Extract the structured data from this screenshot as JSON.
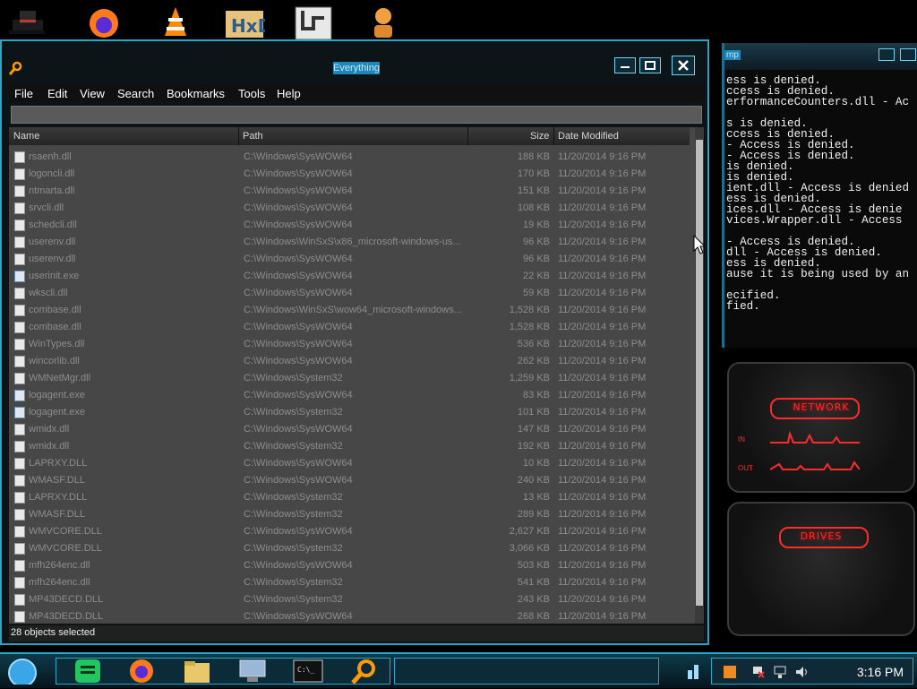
{
  "window": {
    "title": "Everything",
    "menu": [
      "File",
      "Edit",
      "View",
      "Search",
      "Bookmarks",
      "Tools",
      "Help"
    ],
    "columns": {
      "name": "Name",
      "path": "Path",
      "size": "Size",
      "date": "Date Modified"
    },
    "rows": [
      {
        "name": "rsaenh.dll",
        "path": "C:\\Windows\\SysWOW64",
        "size": "188 KB",
        "date": "11/20/2014 9:16 PM",
        "type": "dll"
      },
      {
        "name": "logoncli.dll",
        "path": "C:\\Windows\\SysWOW64",
        "size": "170 KB",
        "date": "11/20/2014 9:16 PM",
        "type": "dll"
      },
      {
        "name": "ntmarta.dll",
        "path": "C:\\Windows\\SysWOW64",
        "size": "151 KB",
        "date": "11/20/2014 9:16 PM",
        "type": "dll"
      },
      {
        "name": "srvcli.dll",
        "path": "C:\\Windows\\SysWOW64",
        "size": "108 KB",
        "date": "11/20/2014 9:16 PM",
        "type": "dll"
      },
      {
        "name": "schedcli.dll",
        "path": "C:\\Windows\\SysWOW64",
        "size": "19 KB",
        "date": "11/20/2014 9:16 PM",
        "type": "dll"
      },
      {
        "name": "userenv.dll",
        "path": "C:\\Windows\\WinSxS\\x86_microsoft-windows-us...",
        "size": "96 KB",
        "date": "11/20/2014 9:16 PM",
        "type": "dll"
      },
      {
        "name": "userenv.dll",
        "path": "C:\\Windows\\SysWOW64",
        "size": "96 KB",
        "date": "11/20/2014 9:16 PM",
        "type": "dll"
      },
      {
        "name": "userinit.exe",
        "path": "C:\\Windows\\SysWOW64",
        "size": "22 KB",
        "date": "11/20/2014 9:16 PM",
        "type": "exe"
      },
      {
        "name": "wkscli.dll",
        "path": "C:\\Windows\\SysWOW64",
        "size": "59 KB",
        "date": "11/20/2014 9:16 PM",
        "type": "dll"
      },
      {
        "name": "combase.dll",
        "path": "C:\\Windows\\WinSxS\\wow64_microsoft-windows...",
        "size": "1,528 KB",
        "date": "11/20/2014 9:16 PM",
        "type": "dll"
      },
      {
        "name": "combase.dll",
        "path": "C:\\Windows\\SysWOW64",
        "size": "1,528 KB",
        "date": "11/20/2014 9:16 PM",
        "type": "dll"
      },
      {
        "name": "WinTypes.dll",
        "path": "C:\\Windows\\SysWOW64",
        "size": "536 KB",
        "date": "11/20/2014 9:16 PM",
        "type": "dll"
      },
      {
        "name": "wincorlib.dll",
        "path": "C:\\Windows\\SysWOW64",
        "size": "262 KB",
        "date": "11/20/2014 9:16 PM",
        "type": "dll"
      },
      {
        "name": "WMNetMgr.dll",
        "path": "C:\\Windows\\System32",
        "size": "1,259 KB",
        "date": "11/20/2014 9:16 PM",
        "type": "dll"
      },
      {
        "name": "logagent.exe",
        "path": "C:\\Windows\\SysWOW64",
        "size": "83 KB",
        "date": "11/20/2014 9:16 PM",
        "type": "exe"
      },
      {
        "name": "logagent.exe",
        "path": "C:\\Windows\\System32",
        "size": "101 KB",
        "date": "11/20/2014 9:16 PM",
        "type": "exe"
      },
      {
        "name": "wmidx.dll",
        "path": "C:\\Windows\\SysWOW64",
        "size": "147 KB",
        "date": "11/20/2014 9:16 PM",
        "type": "dll"
      },
      {
        "name": "wmidx.dll",
        "path": "C:\\Windows\\System32",
        "size": "192 KB",
        "date": "11/20/2014 9:16 PM",
        "type": "dll"
      },
      {
        "name": "LAPRXY.DLL",
        "path": "C:\\Windows\\SysWOW64",
        "size": "10 KB",
        "date": "11/20/2014 9:16 PM",
        "type": "dll"
      },
      {
        "name": "WMASF.DLL",
        "path": "C:\\Windows\\SysWOW64",
        "size": "240 KB",
        "date": "11/20/2014 9:16 PM",
        "type": "dll"
      },
      {
        "name": "LAPRXY.DLL",
        "path": "C:\\Windows\\System32",
        "size": "13 KB",
        "date": "11/20/2014 9:16 PM",
        "type": "dll"
      },
      {
        "name": "WMASF.DLL",
        "path": "C:\\Windows\\System32",
        "size": "289 KB",
        "date": "11/20/2014 9:16 PM",
        "type": "dll"
      },
      {
        "name": "WMVCORE.DLL",
        "path": "C:\\Windows\\SysWOW64",
        "size": "2,627 KB",
        "date": "11/20/2014 9:16 PM",
        "type": "dll"
      },
      {
        "name": "WMVCORE.DLL",
        "path": "C:\\Windows\\System32",
        "size": "3,066 KB",
        "date": "11/20/2014 9:16 PM",
        "type": "dll"
      },
      {
        "name": "mfh264enc.dll",
        "path": "C:\\Windows\\SysWOW64",
        "size": "503 KB",
        "date": "11/20/2014 9:16 PM",
        "type": "dll"
      },
      {
        "name": "mfh264enc.dll",
        "path": "C:\\Windows\\System32",
        "size": "541 KB",
        "date": "11/20/2014 9:16 PM",
        "type": "dll"
      },
      {
        "name": "MP43DECD.DLL",
        "path": "C:\\Windows\\System32",
        "size": "243 KB",
        "date": "11/20/2014 9:16 PM",
        "type": "dll"
      },
      {
        "name": "MP43DECD.DLL",
        "path": "C:\\Windows\\SysWOW64",
        "size": "268 KB",
        "date": "11/20/2014 9:16 PM",
        "type": "dll"
      }
    ],
    "status": "28 objects selected"
  },
  "terminal": {
    "title_fragment": "mp",
    "lines": [
      "ess is denied.",
      "ccess is denied.",
      "erformanceCounters.dll - Ac",
      "",
      "s is denied.",
      "ccess is denied.",
      "- Access is denied.",
      "- Access is denied.",
      "is denied.",
      "is denied.",
      "ient.dll - Access is denied",
      "ess is denied.",
      "ices.dll - Access is denie",
      "vices.Wrapper.dll - Access",
      "",
      "- Access is denied.",
      "dll - Access is denied.",
      "ess is denied.",
      "ause it is being used by an",
      "",
      "ecified.",
      "fied."
    ]
  },
  "gadgets": {
    "network": {
      "title": "NETWORK",
      "in_label": "IN",
      "out_label": "OUT"
    },
    "drives": {
      "title": "DRIVES"
    }
  },
  "taskbar": {
    "clock": "3:16 PM"
  },
  "colors": {
    "accent": "#2aa6c9",
    "list_bg": "#474747",
    "gadget_red": "#ff2a2a"
  }
}
